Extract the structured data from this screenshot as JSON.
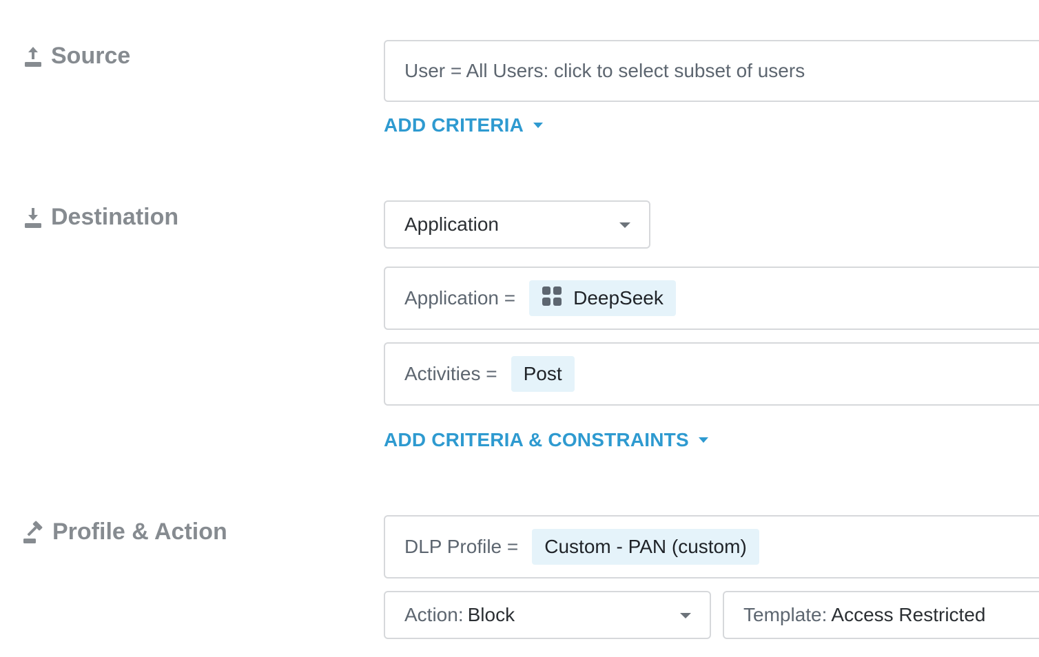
{
  "source": {
    "title": "Source",
    "icon": "upload-icon",
    "user_criteria": "User = All Users: click to select subset of users",
    "add_criteria": "ADD CRITERIA"
  },
  "destination": {
    "title": "Destination",
    "icon": "download-icon",
    "type_select": "Application",
    "application_label": "Application =",
    "application_value": "DeepSeek",
    "application_icon": "app-grid-icon",
    "activities_label": "Activities =",
    "activities_value": "Post",
    "add_criteria": "ADD CRITERIA & CONSTRAINTS"
  },
  "profile_action": {
    "title": "Profile & Action",
    "icon": "gavel-icon",
    "dlp_label": "DLP Profile =",
    "dlp_value": "Custom - PAN (custom)",
    "action_label": "Action:",
    "action_value": "Block",
    "template_label": "Template:",
    "template_value": "Access Restricted"
  },
  "colors": {
    "accent": "#2e9ad0",
    "chip_bg": "#e5f3fa",
    "heading": "#868b90",
    "border": "#d6d8db"
  }
}
